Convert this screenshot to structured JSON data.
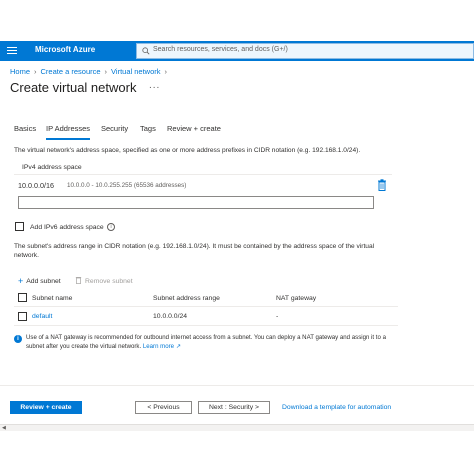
{
  "topbar": {
    "brand": "Microsoft Azure",
    "search_placeholder": "Search resources, services, and docs (G+/)"
  },
  "breadcrumb": [
    "Home",
    "Create a resource",
    "Virtual network"
  ],
  "page": {
    "title": "Create virtual network",
    "more": "..."
  },
  "tabs": [
    {
      "label": "Basics",
      "active": false
    },
    {
      "label": "IP Addresses",
      "active": true
    },
    {
      "label": "Security",
      "active": false
    },
    {
      "label": "Tags",
      "active": false
    },
    {
      "label": "Review + create",
      "active": false
    }
  ],
  "address_space": {
    "description": "The virtual network's address space, specified as one or more address prefixes in CIDR notation (e.g. 192.168.1.0/24).",
    "header": "IPv4 address space",
    "value": "10.0.0.0/16",
    "range": "10.0.0.0 - 10.0.255.255 (65536 addresses)",
    "new_value": ""
  },
  "ipv6": {
    "label": "Add IPv6 address space",
    "checked": false
  },
  "subnet_description": "The subnet's address range in CIDR notation (e.g. 192.168.1.0/24). It must be contained by the address space of the virtual network.",
  "subnet_toolbar": {
    "add": "Add subnet",
    "remove": "Remove subnet"
  },
  "subnet_table": {
    "headers": [
      "Subnet name",
      "Subnet address range",
      "NAT gateway"
    ],
    "rows": [
      {
        "name": "default",
        "range": "10.0.0.0/24",
        "nat": "-"
      }
    ]
  },
  "nat_info": {
    "text": "Use of a NAT gateway is recommended for outbound internet access from a subnet. You can deploy a NAT gateway and assign it to a subnet after you create the virtual network.",
    "link": "Learn more"
  },
  "footer": {
    "review_create": "Review + create",
    "previous": "< Previous",
    "next": "Next : Security >",
    "download_template": "Download a template for automation"
  },
  "colors": {
    "accent": "#0078d4",
    "text": "#323130",
    "muted": "#605e5c"
  }
}
